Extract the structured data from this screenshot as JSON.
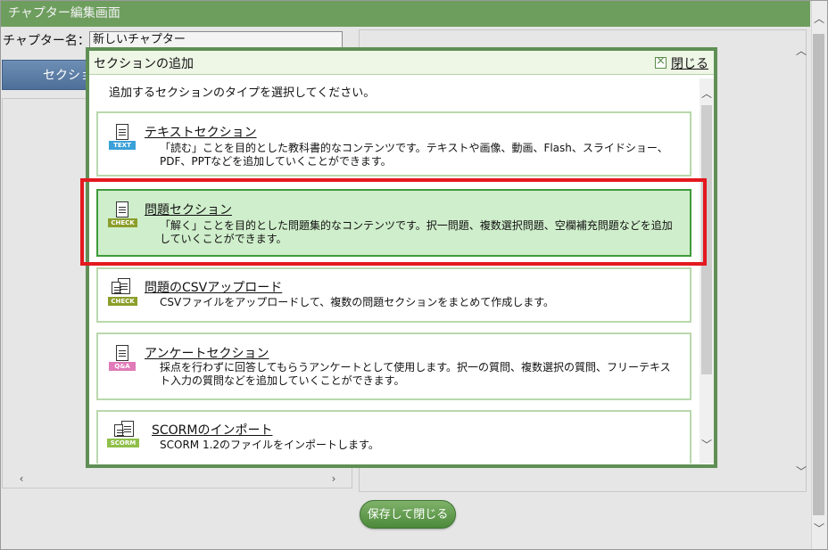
{
  "window": {
    "title": "チャプター編集画面"
  },
  "chapter": {
    "label": "チャプター名：",
    "name_value": "新しいチャプター"
  },
  "toolbar": {
    "section_button_label": "セクショ"
  },
  "footer": {
    "save_button_label": "保存して閉じる"
  },
  "modal": {
    "title": "セクションの追加",
    "close_label": "閉じる",
    "instruction": "追加するセクションのタイプを選択してください。",
    "options": [
      {
        "title": "テキストセクション",
        "icon_tag": "TEXT",
        "icon": "text-section-icon",
        "tag_color": "#3aa0d8",
        "description": "「読む」ことを目的とした教科書的なコンテンツです。テキストや画像、動画、Flash、スライドショー、PDF、PPTなどを追加していくことができます。"
      },
      {
        "title": "問題セクション",
        "icon_tag": "CHECK",
        "icon": "quiz-section-icon",
        "tag_color": "#8b9e2a",
        "selected": true,
        "description": "「解く」ことを目的とした問題集的なコンテンツです。択一問題、複数選択問題、空欄補充問題などを追加していくことができます。"
      },
      {
        "title": "問題のCSVアップロード",
        "icon_tag": "CHECK",
        "icon": "csv-upload-icon",
        "tag_color": "#8b9e2a",
        "description": "CSVファイルをアップロードして、複数の問題セクションをまとめて作成します。"
      },
      {
        "title": "アンケートセクション",
        "icon_tag": "Q&A",
        "icon": "survey-section-icon",
        "tag_color": "#e07ab8",
        "description": "採点を行わずに回答してもらうアンケートとして使用します。択一の質問、複数選択の質問、フリーテキスト入力の質問などを追加していくことができます。"
      },
      {
        "title": "SCORMのインポート",
        "icon_tag": "SCORM",
        "icon": "scorm-import-icon",
        "tag_color": "#8fbf4a",
        "description": "SCORM 1.2のファイルをインポートします。"
      }
    ]
  },
  "colors": {
    "header_green": "#6e9e5e",
    "selected_bg": "#cfeecb",
    "highlight_red": "#e3191f",
    "card_border": "#b9d8ac"
  }
}
